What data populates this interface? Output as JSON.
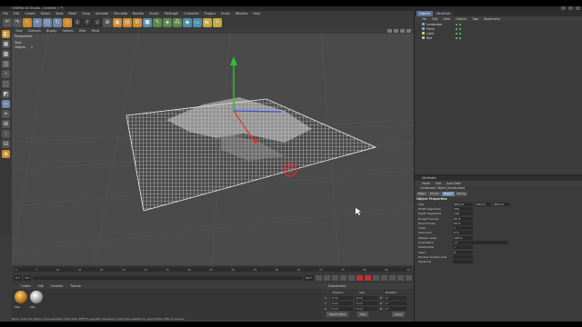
{
  "window": {
    "title": "CINEMA 4D Studio - [Untitled 1 *]"
  },
  "menubar": [
    "File",
    "Edit",
    "Create",
    "Select",
    "Tools",
    "Mesh",
    "Snap",
    "Animate",
    "Simulate",
    "Render",
    "Sculpt",
    "MoGraph",
    "Character",
    "Plugins",
    "Script",
    "Window",
    "Help"
  ],
  "viewport": {
    "menu": [
      "View",
      "Cameras",
      "Display",
      "Options",
      "Filter",
      "Panel"
    ],
    "camera_label": "Perspective",
    "stats": {
      "total_label": "Total",
      "objects_label": "Objects",
      "objects_value": "1"
    }
  },
  "timeline": {
    "ticks": [
      "0",
      "5",
      "10",
      "15",
      "20",
      "25",
      "30",
      "35",
      "40",
      "45",
      "50",
      "55",
      "60",
      "65",
      "70",
      "75",
      "80",
      "85",
      "90"
    ],
    "start": "0 F",
    "end": "90 F",
    "current": "0 F"
  },
  "material": {
    "menu": [
      "Create",
      "Edit",
      "Function",
      "Texture"
    ],
    "items": [
      "Mat",
      "Mat"
    ]
  },
  "coordinates": {
    "title": "Coordinates",
    "columns": [
      "Position",
      "Size",
      "Rotation"
    ],
    "rows": [
      {
        "axis": "X",
        "pos": "0 cm",
        "size": "0 cm",
        "rot_label": "H",
        "rot": "0 °"
      },
      {
        "axis": "Y",
        "pos": "0 cm",
        "size": "0 cm",
        "rot_label": "P",
        "rot": "0 °"
      },
      {
        "axis": "Z",
        "pos": "0 cm",
        "size": "0 cm",
        "rot_label": "B",
        "rot": "0 °"
      }
    ],
    "mode": "Object (Rel)",
    "size_mode": "Size",
    "apply": "Apply"
  },
  "status": "Move: Click and drag to move elements. Hold down SHIFT to quantize movement / add to the selection in point mode, CTRL to remove.",
  "objects_panel": {
    "tabs": [
      "Objects",
      "Structure"
    ],
    "menu": [
      "File",
      "Edit",
      "View",
      "Objects",
      "Tags",
      "Bookmarks"
    ],
    "items": [
      {
        "name": "Landscape",
        "color": "#7fb0e0"
      },
      {
        "name": "Plane",
        "color": "#7fb0e0"
      },
      {
        "name": "Light",
        "color": "#e0d070"
      },
      {
        "name": "Null",
        "color": "#c0c0c0"
      }
    ]
  },
  "attributes": {
    "title": "Attributes",
    "menu": [
      "Mode",
      "Edit",
      "User Data"
    ],
    "object_name": "Landscape Object [Landscape]",
    "tabs": [
      "Basic",
      "Coord.",
      "Object",
      "Phong"
    ],
    "active_tab": "Object",
    "section": "Object Properties",
    "rows": [
      {
        "label": "Size",
        "v1": "400 cm",
        "v2": "100 cm",
        "v3": "400 cm"
      },
      {
        "label": "Width Segments",
        "v1": "100"
      },
      {
        "label": "Depth Segments",
        "v1": "100"
      },
      {
        "label": "Rough Furrows",
        "v1": "50 %"
      },
      {
        "label": "Fine Furrows",
        "v1": "50 %"
      },
      {
        "label": "Scale",
        "v1": "1"
      },
      {
        "label": "Sea Level",
        "v1": "0 %"
      },
      {
        "label": "Plateau Level",
        "v1": "100 %"
      },
      {
        "label": "Orientation",
        "v1": "+Y",
        "wide": true
      },
      {
        "label": "Multifractal",
        "v1": "✓"
      },
      {
        "label": "Seed",
        "v1": "0"
      },
      {
        "label": "Borders At Sea Level",
        "v1": ""
      },
      {
        "label": "Spherical",
        "v1": ""
      }
    ]
  },
  "colors": {
    "accent": "#6f87a9",
    "bg": "#3c3c3c",
    "viewport": "#4a4a4a",
    "axis_y": "#2ec02e",
    "axis_x": "#e03030",
    "axis_z": "#3050e0"
  }
}
